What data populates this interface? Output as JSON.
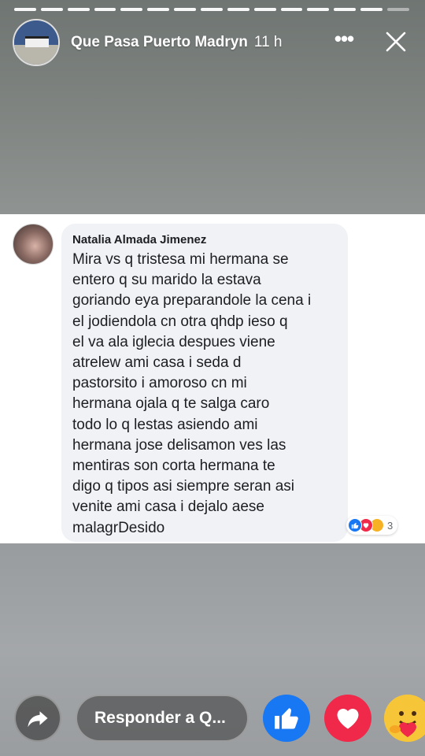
{
  "story": {
    "page_name": "Que Pasa Puerto Madryn",
    "time_ago": "11 h",
    "more_icon": "more-options-icon",
    "close_icon": "close-icon",
    "progress_segments_total": 15,
    "progress_segments_viewed": 14
  },
  "comment": {
    "author": "Natalia Almada Jimenez",
    "text": "Mira  vs q tristesa mi hermana se\nentero  q su marido la estava\ngoriando eya preparandole la cena i\nel  jodiendola cn otra  qhdp  ieso q\nel va ala iglecia    despues viene\natrelew ami casa i seda d\npastorsito   i amoroso cn mi\nhermana   ojala q te salga caro\ntodo lo q lestas asiendo ami\nhermana jose delisamon ves las\nmentiras son corta   hermana  te\ndigo q tipos asi siempre seran asi\nvenite ami casa i dejalo aese\nmalagrDesido",
    "reaction_count": "3",
    "reaction_types": [
      "like",
      "love",
      "care"
    ]
  },
  "footer": {
    "reply_placeholder": "Responder a Q...",
    "share_icon": "share-arrow-icon",
    "like_icon": "thumbs-up-icon",
    "love_icon": "heart-icon",
    "care_icon": "care-emoji-icon"
  },
  "colors": {
    "like_blue": "#1877f2",
    "love_red": "#f02849",
    "care_yellow": "#f7b125",
    "bubble_bg": "#f0f2f5"
  }
}
